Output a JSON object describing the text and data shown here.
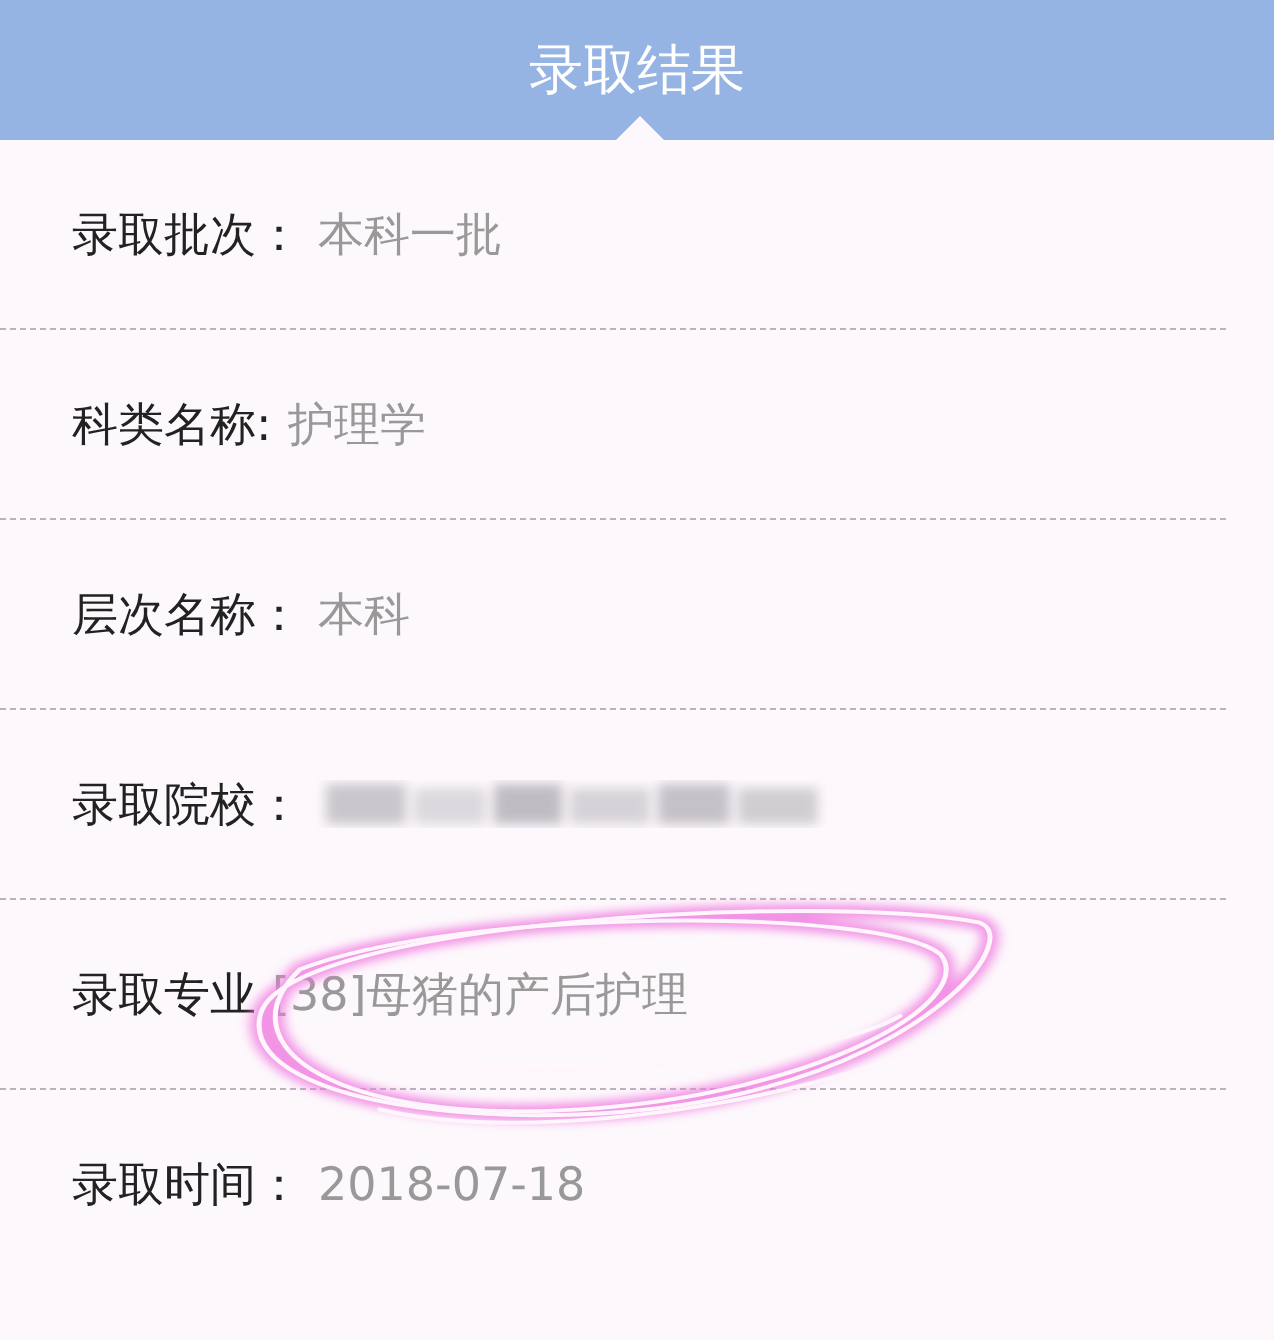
{
  "header": {
    "title": "录取结果"
  },
  "rows": [
    {
      "kind": "text",
      "label": "录取批次：",
      "value": "本科一批"
    },
    {
      "kind": "text",
      "label": "科类名称:",
      "value": "护理学"
    },
    {
      "kind": "text",
      "label": "层次名称：",
      "value": "本科"
    },
    {
      "kind": "redacted",
      "label": "录取院校："
    },
    {
      "kind": "text",
      "label": "录取专业",
      "value": "[38]母猪的产后护理"
    },
    {
      "kind": "text",
      "label": "录取时间：",
      "value": "2018-07-18"
    }
  ],
  "annotation": {
    "kind": "scribble"
  }
}
